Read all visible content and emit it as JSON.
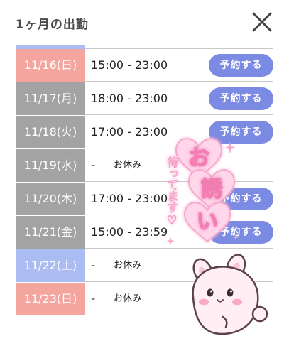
{
  "header": {
    "title": "1ヶ月の出勤"
  },
  "schedule": [
    {
      "date": "11/16(日)",
      "day_type": "sun",
      "time": "15:00 - 23:00",
      "button": "予約する"
    },
    {
      "date": "11/17(月)",
      "day_type": "wk",
      "time": "18:00 - 23:00",
      "button": "予約する"
    },
    {
      "date": "11/18(火)",
      "day_type": "wk",
      "time": "17:00 - 23:00",
      "button": "予約する"
    },
    {
      "date": "11/19(水)",
      "day_type": "wk",
      "dash": "-",
      "off": "お休み"
    },
    {
      "date": "11/20(木)",
      "day_type": "wk",
      "time": "17:00 - 23:00",
      "button": "予約する"
    },
    {
      "date": "11/21(金)",
      "day_type": "wk",
      "time": "15:00 - 23:59",
      "button": "予約する"
    },
    {
      "date": "11/22(土)",
      "day_type": "sat",
      "dash": "-",
      "off": "お休み"
    },
    {
      "date": "11/23(日)",
      "day_type": "sun",
      "dash": "-",
      "off": "お休み"
    }
  ],
  "overlay": {
    "big_text": [
      "お",
      "誘",
      "い"
    ],
    "small_text": "待ってます♡"
  },
  "colors": {
    "sunday": "#f4a59d",
    "weekday": "#a3a3a3",
    "saturday": "#aabcf2",
    "button": "#7b8ae2"
  },
  "icons": {
    "close": "close-icon",
    "mascot": "bunny-mascot"
  }
}
